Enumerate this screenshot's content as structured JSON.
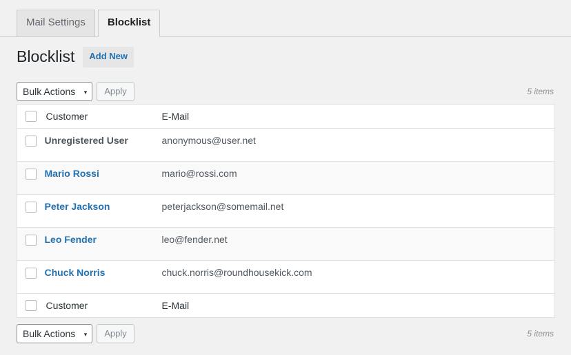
{
  "tabs": [
    {
      "label": "Mail Settings",
      "active": false
    },
    {
      "label": "Blocklist",
      "active": true
    }
  ],
  "header": {
    "title": "Blocklist",
    "add_new_label": "Add New"
  },
  "tablenav": {
    "bulk_actions_label": "Bulk Actions",
    "caret_glyph": "▾",
    "apply_label": "Apply",
    "items_count_top": "5 items",
    "items_count_bottom": "5 items"
  },
  "table": {
    "columns": {
      "customer": "Customer",
      "email": "E-Mail"
    },
    "rows": [
      {
        "name": "Unregistered User",
        "email": "anonymous@user.net",
        "is_link": false
      },
      {
        "name": "Mario Rossi",
        "email": "mario@rossi.com",
        "is_link": true
      },
      {
        "name": "Peter Jackson",
        "email": "peterjackson@somemail.net",
        "is_link": true
      },
      {
        "name": "Leo Fender",
        "email": "leo@fender.net",
        "is_link": true
      },
      {
        "name": "Chuck Norris",
        "email": "chuck.norris@roundhousekick.com",
        "is_link": true
      }
    ]
  },
  "colors": {
    "page_bg": "#f1f1f1",
    "link": "#2271b1",
    "text": "#50575e",
    "border": "#e1e1e1",
    "row_alt": "#f9f9f9"
  }
}
